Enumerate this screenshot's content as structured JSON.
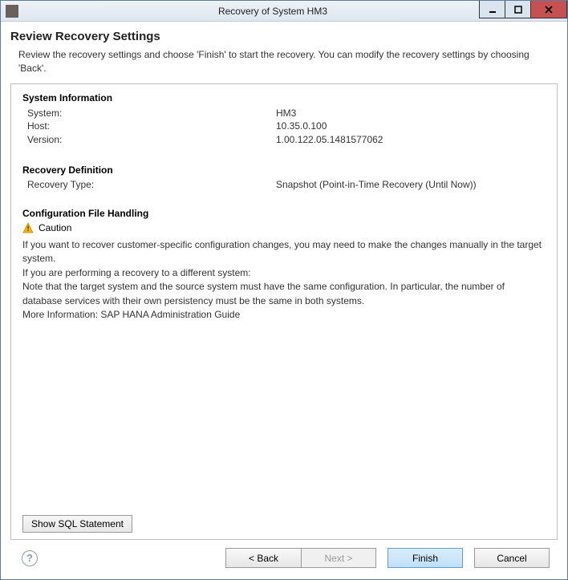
{
  "titlebar": {
    "title": "Recovery of System HM3"
  },
  "page": {
    "title": "Review Recovery Settings",
    "subtitle": "Review the recovery settings and choose 'Finish' to start the recovery. You can modify the recovery settings by choosing 'Back'."
  },
  "system_info": {
    "header": "System Information",
    "system_label": "System:",
    "system_value": "HM3",
    "host_label": "Host:",
    "host_value": "10.35.0.100",
    "version_label": "Version:",
    "version_value": "1.00.122.05.1481577062"
  },
  "recovery_def": {
    "header": "Recovery Definition",
    "type_label": "Recovery Type:",
    "type_value": "Snapshot (Point-in-Time Recovery (Until Now))"
  },
  "config_handling": {
    "header": "Configuration File Handling",
    "caution_label": "Caution",
    "text1": "If you want to recover customer-specific configuration changes, you may need to make the changes manually in the target system.",
    "text2": "If you are performing a recovery to a different system:",
    "text3": "Note that the target system and the source system must have the same configuration. In particular, the number of database services with their own persistency must be the same in both systems.",
    "text4": "More Information: SAP HANA Administration Guide"
  },
  "buttons": {
    "sql": "Show SQL Statement",
    "back": "< Back",
    "next": "Next >",
    "finish": "Finish",
    "cancel": "Cancel"
  }
}
